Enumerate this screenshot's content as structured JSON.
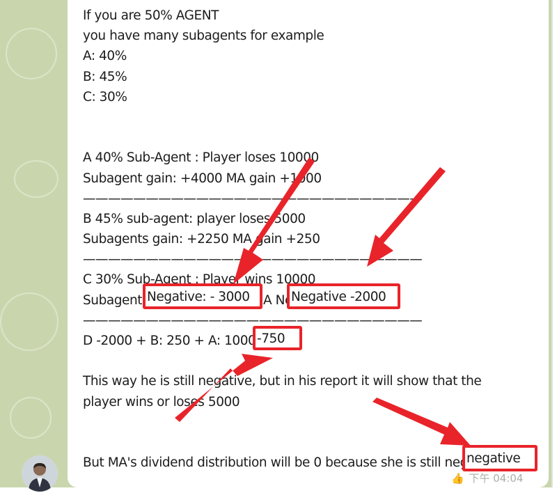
{
  "message": {
    "lines": [
      "If you are 50% AGENT",
      "you have many subagents for example",
      "A: 40%",
      "B: 45%",
      "C: 30%",
      "",
      "",
      "A 40% Sub-Agent : Player loses 10000",
      "Subagent gain: +4000 MA gain +1000",
      "———————————————————————————",
      "B 45% sub-agent: player loses 5000",
      "Subagents gain: +2250 MA gain +250",
      "———————————————————————————",
      "C 30% Sub-Agent : Player wins 10000",
      "Subagent Negative: - 3000 MA Negative -2000",
      "———————————————————————————",
      "D -2000 + B: 250 + A: 1000 = -750",
      "",
      "This way he is still negative, but in his report it will show that the",
      "player wins or loses 5000",
      "",
      "",
      "But MA's dividend distribution will be 0 because she is still negative"
    ]
  },
  "highlights": {
    "sub_negative": "Negative: - 3000",
    "ma_negative": "Negative -2000",
    "total": "-750",
    "final": "negative"
  },
  "meta": {
    "reaction": "👍",
    "time": "下午 04:04"
  },
  "colors": {
    "chat_background": "#c9d6ad",
    "bubble": "#ffffff",
    "annotation_red": "#e8242a"
  }
}
